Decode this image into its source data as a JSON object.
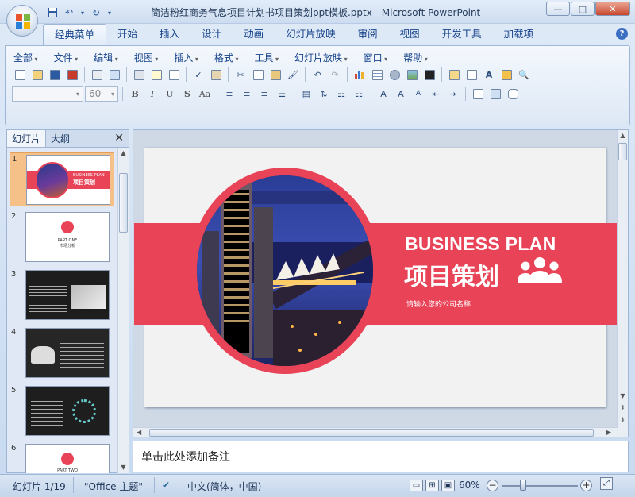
{
  "window": {
    "title": "简洁粉红商务气息项目计划书项目策划ppt模板.pptx - Microsoft PowerPoint",
    "controls": [
      "—",
      "□",
      "✕"
    ]
  },
  "ribbon_tabs": [
    "经典菜单",
    "开始",
    "插入",
    "设计",
    "动画",
    "幻灯片放映",
    "审阅",
    "视图",
    "开发工具",
    "加载项"
  ],
  "active_tab": "经典菜单",
  "classic_menu": [
    "全部",
    "文件",
    "编辑",
    "视图",
    "插入",
    "格式",
    "工具",
    "幻灯片放映",
    "窗口",
    "帮助"
  ],
  "font": {
    "name": "",
    "size": "60"
  },
  "pane": {
    "tabs": [
      "幻灯片",
      "大纲"
    ],
    "close": "✕"
  },
  "thumbnails": [
    "1",
    "2",
    "3",
    "4",
    "5",
    "6"
  ],
  "slide": {
    "title_en": "BUSINESS PLAN",
    "title_cn": "项目策划",
    "subtitle": "请输入您的公司名称",
    "accent": "#e84357"
  },
  "thumb1": {
    "t1": "BUSINESS PLAN",
    "t2": "项目策划"
  },
  "thumb2": {
    "t1": "PART ONE",
    "t2": "市场分析"
  },
  "thumb6": {
    "t1": "PART TWO"
  },
  "notes": {
    "placeholder": "单击此处添加备注"
  },
  "status": {
    "slide": "幻灯片 1/19",
    "theme": "\"Office 主题\"",
    "language": "中文(简体，中国)",
    "zoom": "60%"
  }
}
